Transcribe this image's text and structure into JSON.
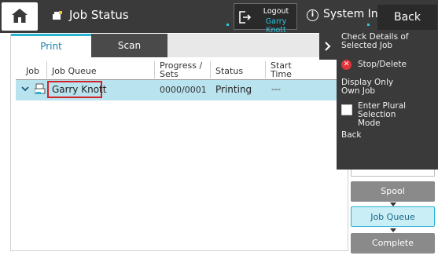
{
  "header": {
    "title": "Job Status",
    "logout_label": "Logout",
    "logout_user": "Garry Knott",
    "system_info_label": "System Info.",
    "back_label": "Back"
  },
  "tabs": [
    {
      "label": "Print",
      "active": true
    },
    {
      "label": "Scan",
      "active": false
    }
  ],
  "table": {
    "columns": [
      "Job",
      "Job Queue",
      "Progress / Sets",
      "Status",
      "Start Time"
    ],
    "rows": [
      {
        "queue": "Garry Knott",
        "progress": "0000/0001",
        "status": "Printing",
        "start_time": "---",
        "selected": true
      }
    ]
  },
  "menu": {
    "items": [
      {
        "label": "Check Details of Selected Job"
      },
      {
        "label": "Stop/Delete",
        "icon": "x-circle-icon"
      },
      {
        "label": "Display Only Own Job"
      },
      {
        "label": "Enter Plural Selection Mode",
        "checkbox": true,
        "checked": false
      },
      {
        "label": "Back"
      }
    ]
  },
  "side_buttons": {
    "spool": "Spool",
    "job_queue": "Job Queue",
    "complete": "Complete"
  },
  "colors": {
    "topbar": "#3a3a3a",
    "accent": "#2bb3d0",
    "selected_row": "#b9e3ee",
    "highlight_border": "#d0232a",
    "stop_icon": "#e0353b"
  }
}
